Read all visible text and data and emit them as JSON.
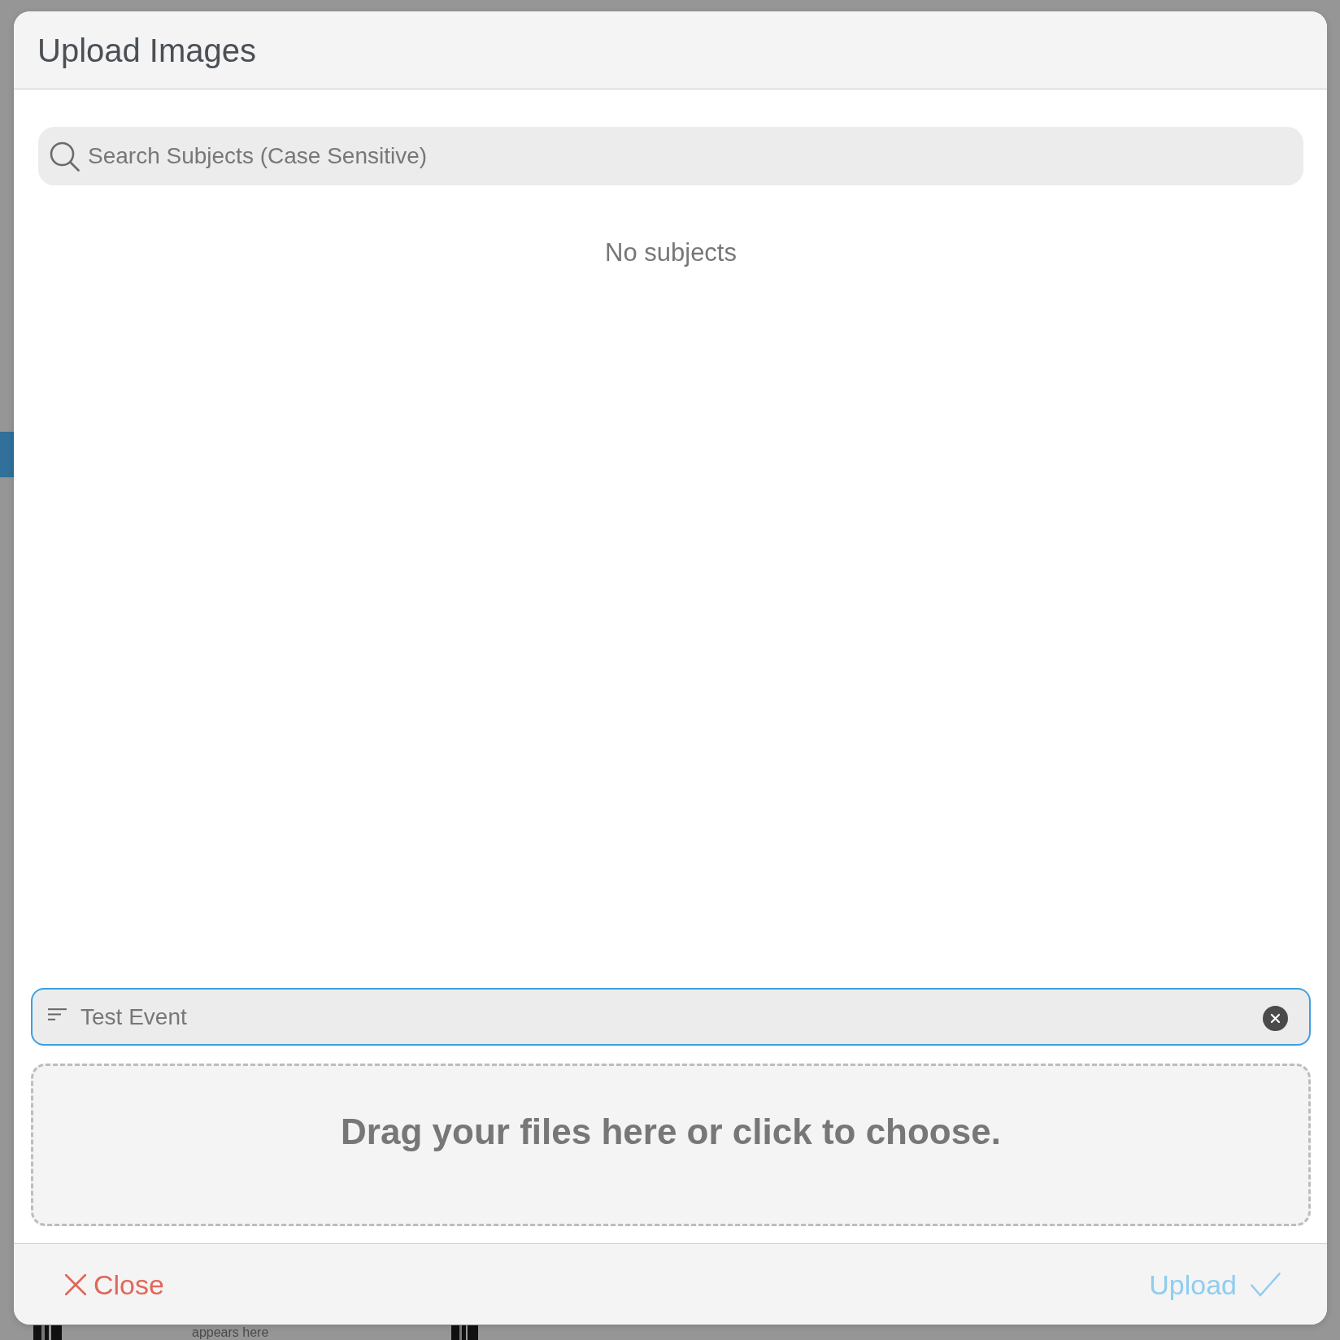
{
  "dialog": {
    "title": "Upload Images"
  },
  "search": {
    "placeholder": "Search Subjects (Case Sensitive)"
  },
  "empty_message": "No subjects",
  "event_field": {
    "value": "Test Event",
    "focused": true
  },
  "dropzone": {
    "text": "Drag your files here or click to choose."
  },
  "footer": {
    "close_button": {
      "label": "Close"
    },
    "upload_button": {
      "label": "Upload",
      "disabled": true
    }
  },
  "backdrop": {
    "caption": "appears here"
  }
}
